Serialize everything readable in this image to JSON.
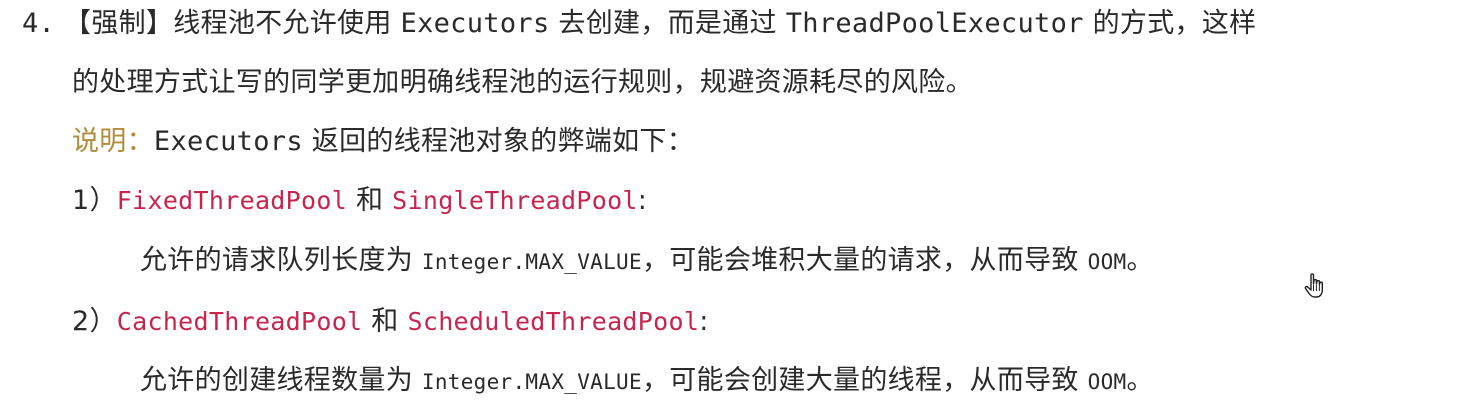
{
  "item4": {
    "number": "4.",
    "tag": "【强制】",
    "text_a": "线程池不允许使用",
    "executors": "Executors",
    "text_b": "去创建，而是通过",
    "tpe": "ThreadPoolExecutor",
    "text_c": "的方式，这样",
    "line2": "的处理方式让写的同学更加明确线程池的运行规则，规避资源耗尽的风险。"
  },
  "explanation": {
    "label": "说明：",
    "executors": "Executors",
    "text": "返回的线程池对象的弊端如下："
  },
  "points": [
    {
      "index": "1）",
      "pool_a": "FixedThreadPool",
      "and": "和",
      "pool_b": "SingleThreadPool",
      "colon": ":",
      "desc_a": "允许的请求队列长度为",
      "code": "Integer.MAX_VALUE",
      "desc_b": "，可能会堆积大量的请求，从而导致",
      "oom": "OOM",
      "end": "。"
    },
    {
      "index": "2）",
      "pool_a": "CachedThreadPool",
      "and": "和",
      "pool_b": "ScheduledThreadPool",
      "colon": ":",
      "desc_a": "允许的创建线程数量为",
      "code": "Integer.MAX_VALUE",
      "desc_b": "，可能会创建大量的线程，从而导致",
      "oom": "OOM",
      "end": "。"
    }
  ],
  "colors": {
    "text": "#2a2a2a",
    "code_red": "#c7254e",
    "label_gold": "#b08d3a"
  },
  "icons": {
    "cursor": "hand-pointer-icon"
  }
}
